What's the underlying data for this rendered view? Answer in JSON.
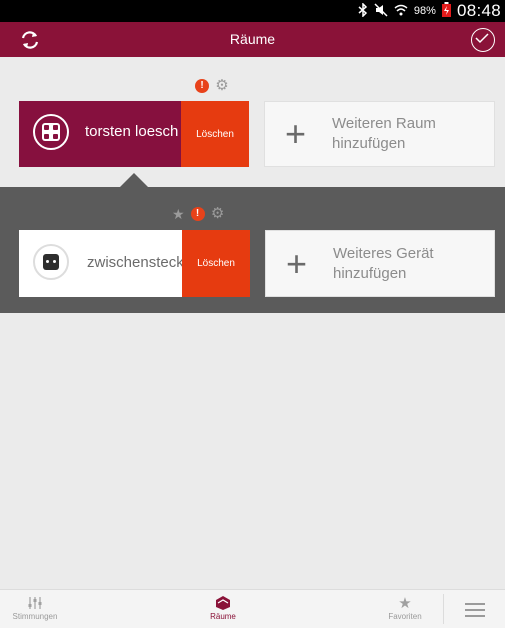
{
  "status_bar": {
    "battery_percent": "98%",
    "time": "08:48"
  },
  "app_bar": {
    "title": "Räume",
    "refresh_icon": "refresh-icon",
    "confirm_icon": "check-circle-icon"
  },
  "rooms": [
    {
      "label": "torsten loesch",
      "delete_label": "Löschen",
      "icon": "grid-room-icon"
    }
  ],
  "add_room": {
    "label": "Weiteren Raum\nhinzufügen"
  },
  "devices": [
    {
      "label": "zwischenstecker",
      "delete_label": "Löschen",
      "icon": "plug-icon"
    }
  ],
  "add_device": {
    "label": "Weiteres Gerät\nhinzufügen"
  },
  "bottom_nav": {
    "items": [
      {
        "label": "Stimmungen",
        "icon": "sliders-icon",
        "active": false
      },
      {
        "label": "Räume",
        "icon": "room-icon",
        "active": true
      },
      {
        "label": "Favoriten",
        "icon": "star-icon",
        "active": false
      }
    ],
    "menu_icon": "menu-icon"
  },
  "colors": {
    "brand": "#8a1238",
    "delete": "#e63b10",
    "warning": "#e8421a",
    "panel": "#5b5b5b"
  }
}
